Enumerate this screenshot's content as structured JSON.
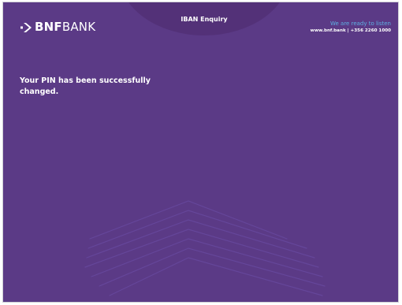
{
  "header": {
    "logo": {
      "strong_text": "BNF",
      "text": "BANK",
      "icon": "bnf-chevron-logo-icon"
    },
    "title": "IBAN Enquiry",
    "contact": {
      "slogan": "We are ready to listen",
      "info": "www.bnf.bank | +356 2260 1000"
    }
  },
  "main": {
    "message": "Your PIN has been successfully changed."
  },
  "colors": {
    "background": "#5b3a86",
    "accent": "#5fb0e3",
    "text": "#ffffff"
  }
}
